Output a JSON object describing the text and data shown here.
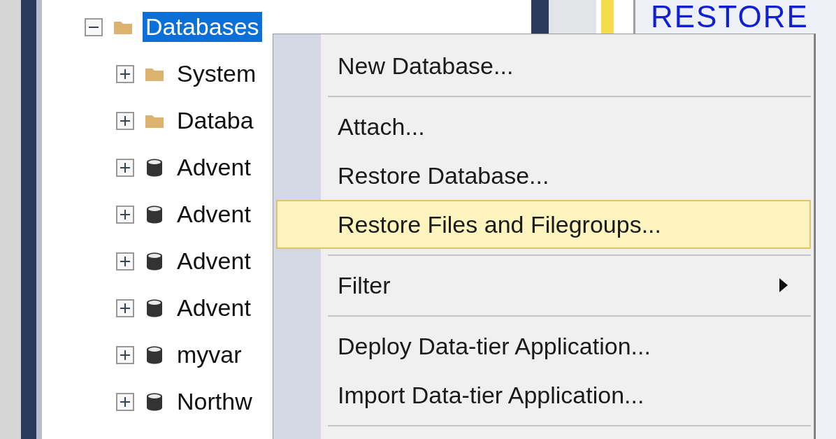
{
  "object_explorer": {
    "tree": [
      {
        "label": "Databases",
        "kind": "folder",
        "expanded": true,
        "selected": true,
        "children": [
          {
            "label": "System",
            "kind": "folder",
            "expanded": false,
            "selected": false
          },
          {
            "label": "Databa",
            "kind": "folder",
            "expanded": false,
            "selected": false
          },
          {
            "label": "Advent",
            "kind": "database",
            "expanded": false,
            "selected": false
          },
          {
            "label": "Advent",
            "kind": "database",
            "expanded": false,
            "selected": false
          },
          {
            "label": "Advent",
            "kind": "database",
            "expanded": false,
            "selected": false
          },
          {
            "label": "Advent",
            "kind": "database",
            "expanded": false,
            "selected": false
          },
          {
            "label": "myvar",
            "kind": "database",
            "expanded": false,
            "selected": false
          },
          {
            "label": "Northw",
            "kind": "database",
            "expanded": false,
            "selected": false
          }
        ]
      }
    ]
  },
  "editor": {
    "text": "RESTORE"
  },
  "context_menu": {
    "items": [
      {
        "kind": "item",
        "label": "New Database...",
        "selected": false
      },
      {
        "kind": "separator"
      },
      {
        "kind": "item",
        "label": "Attach...",
        "selected": false
      },
      {
        "kind": "item",
        "label": "Restore Database...",
        "selected": false
      },
      {
        "kind": "item",
        "label": "Restore Files and Filegroups...",
        "selected": true
      },
      {
        "kind": "separator"
      },
      {
        "kind": "submenu",
        "label": "Filter",
        "selected": false
      },
      {
        "kind": "separator"
      },
      {
        "kind": "item",
        "label": "Deploy Data-tier Application...",
        "selected": false
      },
      {
        "kind": "item",
        "label": "Import Data-tier Application...",
        "selected": false
      },
      {
        "kind": "separator"
      }
    ]
  }
}
